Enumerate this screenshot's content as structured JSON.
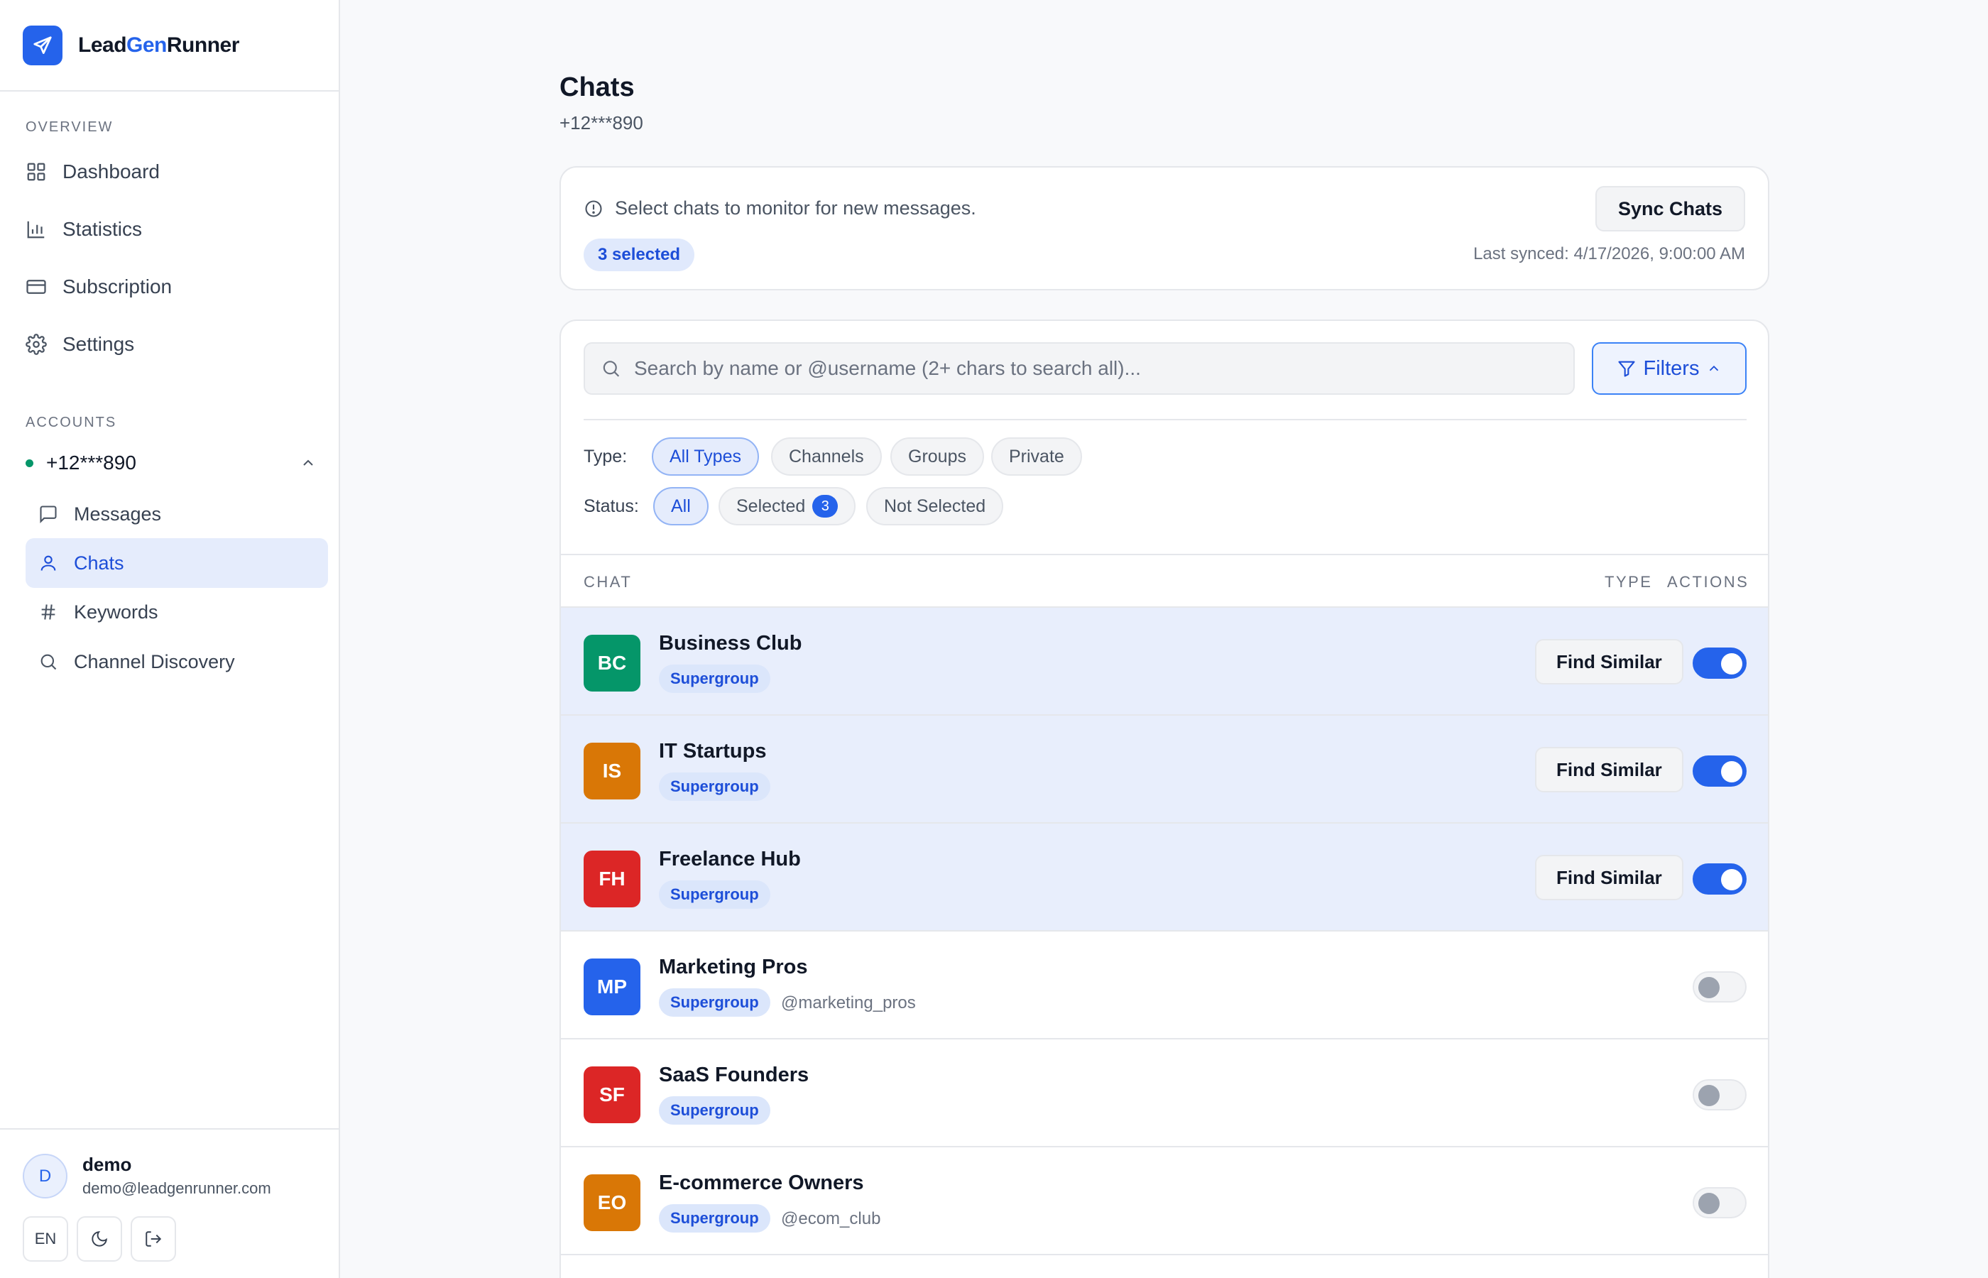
{
  "app": {
    "name_part1": "Lead",
    "name_part2": "Gen",
    "name_part3": "Runner"
  },
  "sidebar": {
    "overview_label": "OVERVIEW",
    "nav": [
      {
        "label": "Dashboard",
        "icon": "grid-icon"
      },
      {
        "label": "Statistics",
        "icon": "bar-chart-icon"
      },
      {
        "label": "Subscription",
        "icon": "credit-card-icon"
      },
      {
        "label": "Settings",
        "icon": "gear-icon"
      }
    ],
    "accounts_label": "ACCOUNTS",
    "account": {
      "phone": "+12***890",
      "status_color": "#059669"
    },
    "sub": [
      {
        "label": "Messages",
        "icon": "message-icon"
      },
      {
        "label": "Chats",
        "icon": "user-icon",
        "active": true
      },
      {
        "label": "Keywords",
        "icon": "hash-icon"
      },
      {
        "label": "Channel Discovery",
        "icon": "search-icon"
      }
    ],
    "user": {
      "initial": "D",
      "name": "demo",
      "email": "demo@leadgenrunner.com",
      "lang": "EN"
    }
  },
  "header": {
    "title": "Chats",
    "subtitle": "+12***890"
  },
  "info": {
    "text": "Select chats to monitor for new messages.",
    "selected": "3 selected",
    "sync_label": "Sync Chats",
    "last_synced": "Last synced: 4/17/2026, 9:00:00 AM"
  },
  "search": {
    "placeholder": "Search by name or @username (2+ chars to search all)...",
    "filters_label": "Filters"
  },
  "filters": {
    "type_label": "Type:",
    "types": [
      "All Types",
      "Channels",
      "Groups",
      "Private"
    ],
    "status_label": "Status:",
    "status_all": "All",
    "status_selected": "Selected",
    "status_selected_count": "3",
    "status_not_selected": "Not Selected"
  },
  "table": {
    "col_chat": "CHAT",
    "col_type": "TYPE",
    "col_actions": "ACTIONS",
    "find_label": "Find Similar"
  },
  "chats": [
    {
      "initials": "BC",
      "name": "Business Club",
      "tag": "Supergroup",
      "username": "",
      "color": "#059669",
      "selected": true
    },
    {
      "initials": "IS",
      "name": "IT Startups",
      "tag": "Supergroup",
      "username": "",
      "color": "#d97706",
      "selected": true
    },
    {
      "initials": "FH",
      "name": "Freelance Hub",
      "tag": "Supergroup",
      "username": "",
      "color": "#dc2626",
      "selected": true
    },
    {
      "initials": "MP",
      "name": "Marketing Pros",
      "tag": "Supergroup",
      "username": "@marketing_pros",
      "color": "#2563eb",
      "selected": false
    },
    {
      "initials": "SF",
      "name": "SaaS Founders",
      "tag": "Supergroup",
      "username": "",
      "color": "#dc2626",
      "selected": false
    },
    {
      "initials": "EO",
      "name": "E-commerce Owners",
      "tag": "Supergroup",
      "username": "@ecom_club",
      "color": "#d97706",
      "selected": false
    }
  ]
}
